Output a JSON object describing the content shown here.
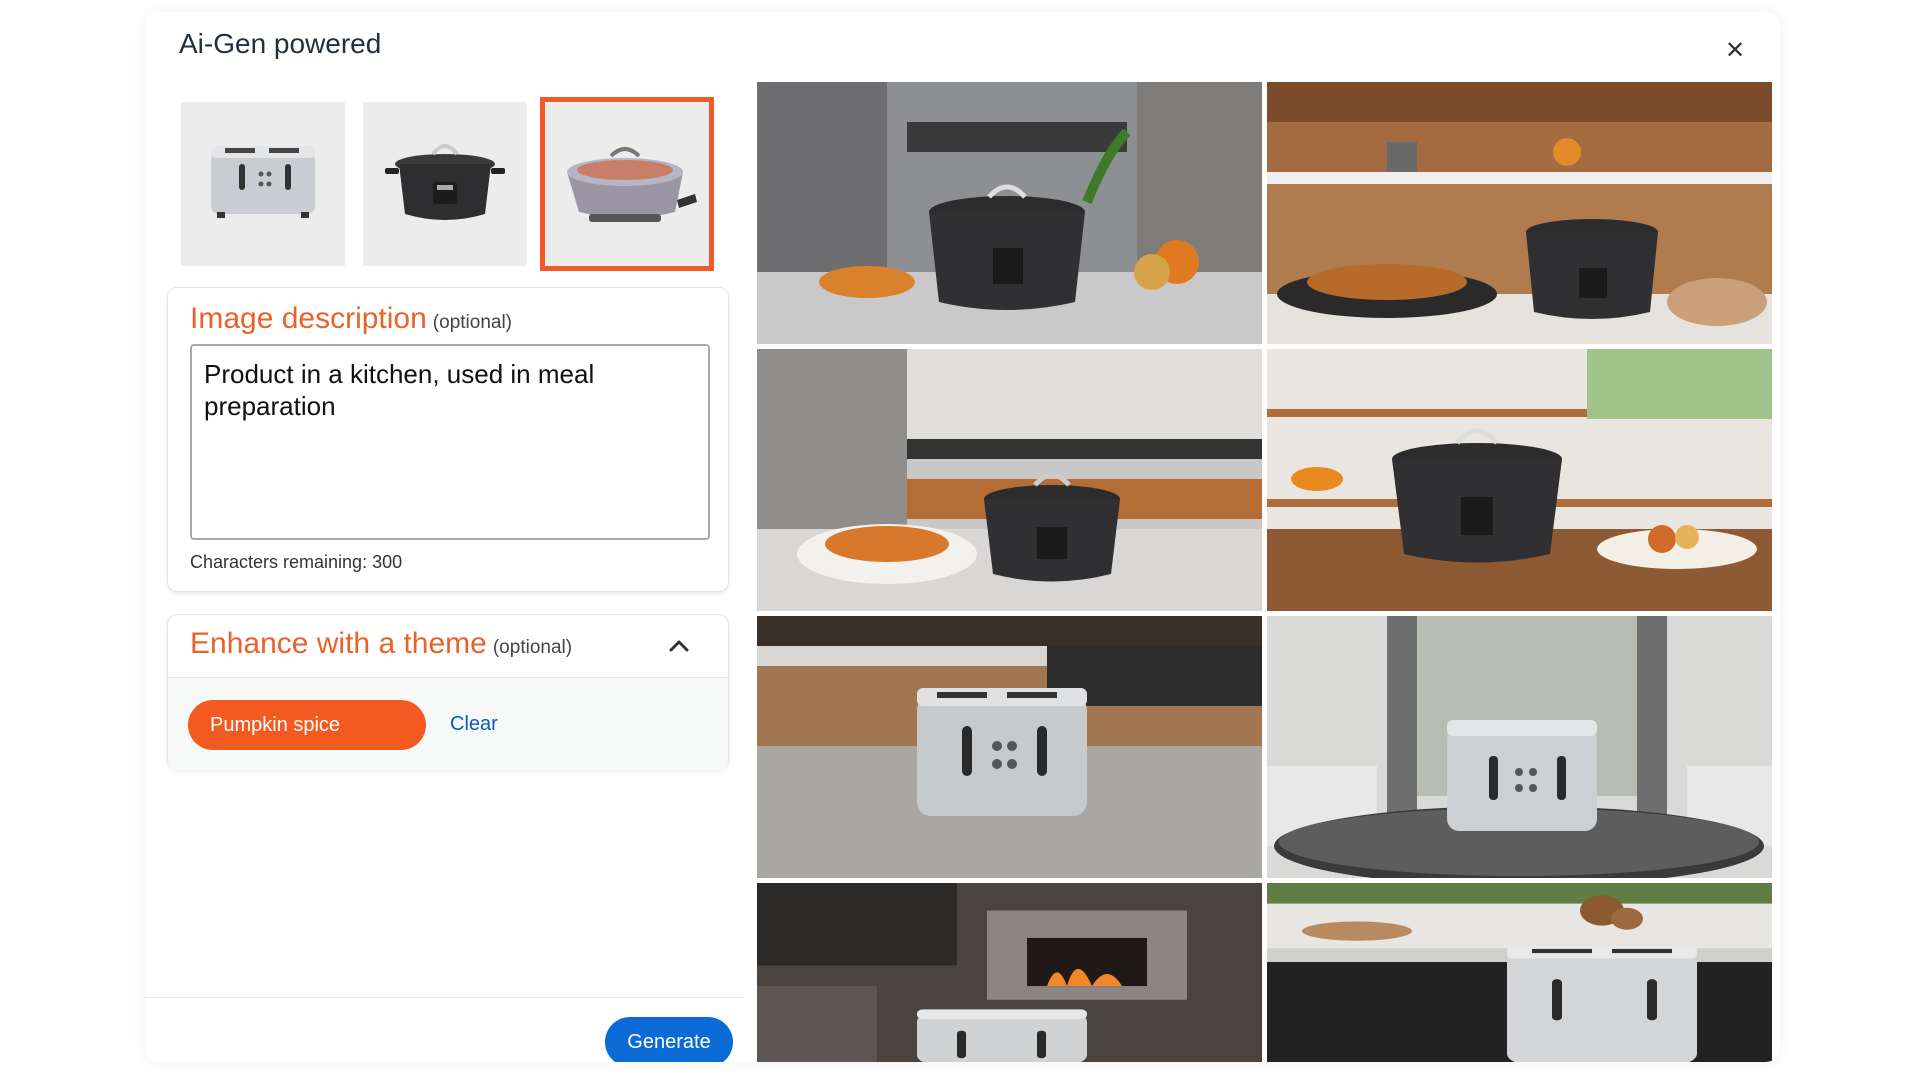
{
  "modal": {
    "title": "Ai-Gen powered",
    "close_icon": "close-icon"
  },
  "thumbnails": [
    {
      "name": "toaster",
      "selected": false
    },
    {
      "name": "slow-cooker",
      "selected": false
    },
    {
      "name": "electric-skillet",
      "selected": true
    }
  ],
  "description": {
    "title": "Image description",
    "optional": "(optional)",
    "value": "Product in a kitchen, used in meal preparation",
    "chars_remaining": "Characters remaining: 300"
  },
  "theme": {
    "title": "Enhance with a theme",
    "optional": "(optional)",
    "selected": "Pumpkin spice",
    "clear": "Clear"
  },
  "generate_label": "Generate",
  "colors": {
    "accent": "#e8622c",
    "pill": "#f25a20",
    "link": "#0b5bbf",
    "primary_button": "#0a6bd6"
  },
  "results": [
    {
      "subject": "slow-cooker",
      "scene": "modern kitchen counter with vegetables"
    },
    {
      "subject": "slow-cooker",
      "scene": "wood kitchen with food platter"
    },
    {
      "subject": "slow-cooker",
      "scene": "marble kitchen with curry bowl"
    },
    {
      "subject": "slow-cooker",
      "scene": "bright kitchen with wooden board"
    },
    {
      "subject": "toaster",
      "scene": "rustic kitchen with stove"
    },
    {
      "subject": "toaster",
      "scene": "living room table"
    },
    {
      "subject": "toaster",
      "scene": "fireplace lounge"
    },
    {
      "subject": "toaster",
      "scene": "dark kitchen counter with bread"
    }
  ]
}
